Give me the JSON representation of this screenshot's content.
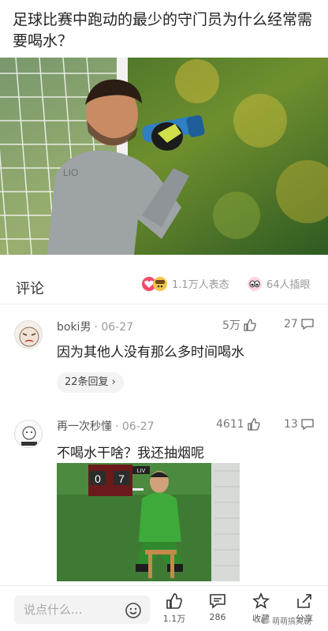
{
  "question": {
    "title": "足球比赛中跑动的最少的守门员为什么经常需要喝水？"
  },
  "hero_image": {
    "description_icon": "goalkeeper-drinking-photo"
  },
  "comments_section": {
    "title": "评论",
    "reactions_label": "1.1万人表态",
    "watchers_label": "64人插眼"
  },
  "comments": [
    {
      "user": "boki男",
      "date": "· 06-27",
      "likes": "5万",
      "reply_count_short": "27",
      "text": "因为其他人没有那么多时间喝水",
      "replies_label": "22条回复 ›"
    },
    {
      "user": "再一次秒懂",
      "date": "· 06-27",
      "likes": "4611",
      "reply_count_short": "13",
      "text": "不喝水干啥？我还抽烟呢",
      "image_score_left": "0",
      "image_score_right": "7",
      "image_live": "LIV"
    }
  ],
  "bottom_bar": {
    "input_placeholder": "说点什么...",
    "like_count": "1.1万",
    "comment_count": "286",
    "favorite_label": "收藏",
    "share_label": "分享"
  },
  "watermark": {
    "text": "萌萌搞笑剧"
  },
  "colors": {
    "accent_pink": "#f04a6b",
    "text_primary": "#222222",
    "text_secondary": "#999999"
  }
}
